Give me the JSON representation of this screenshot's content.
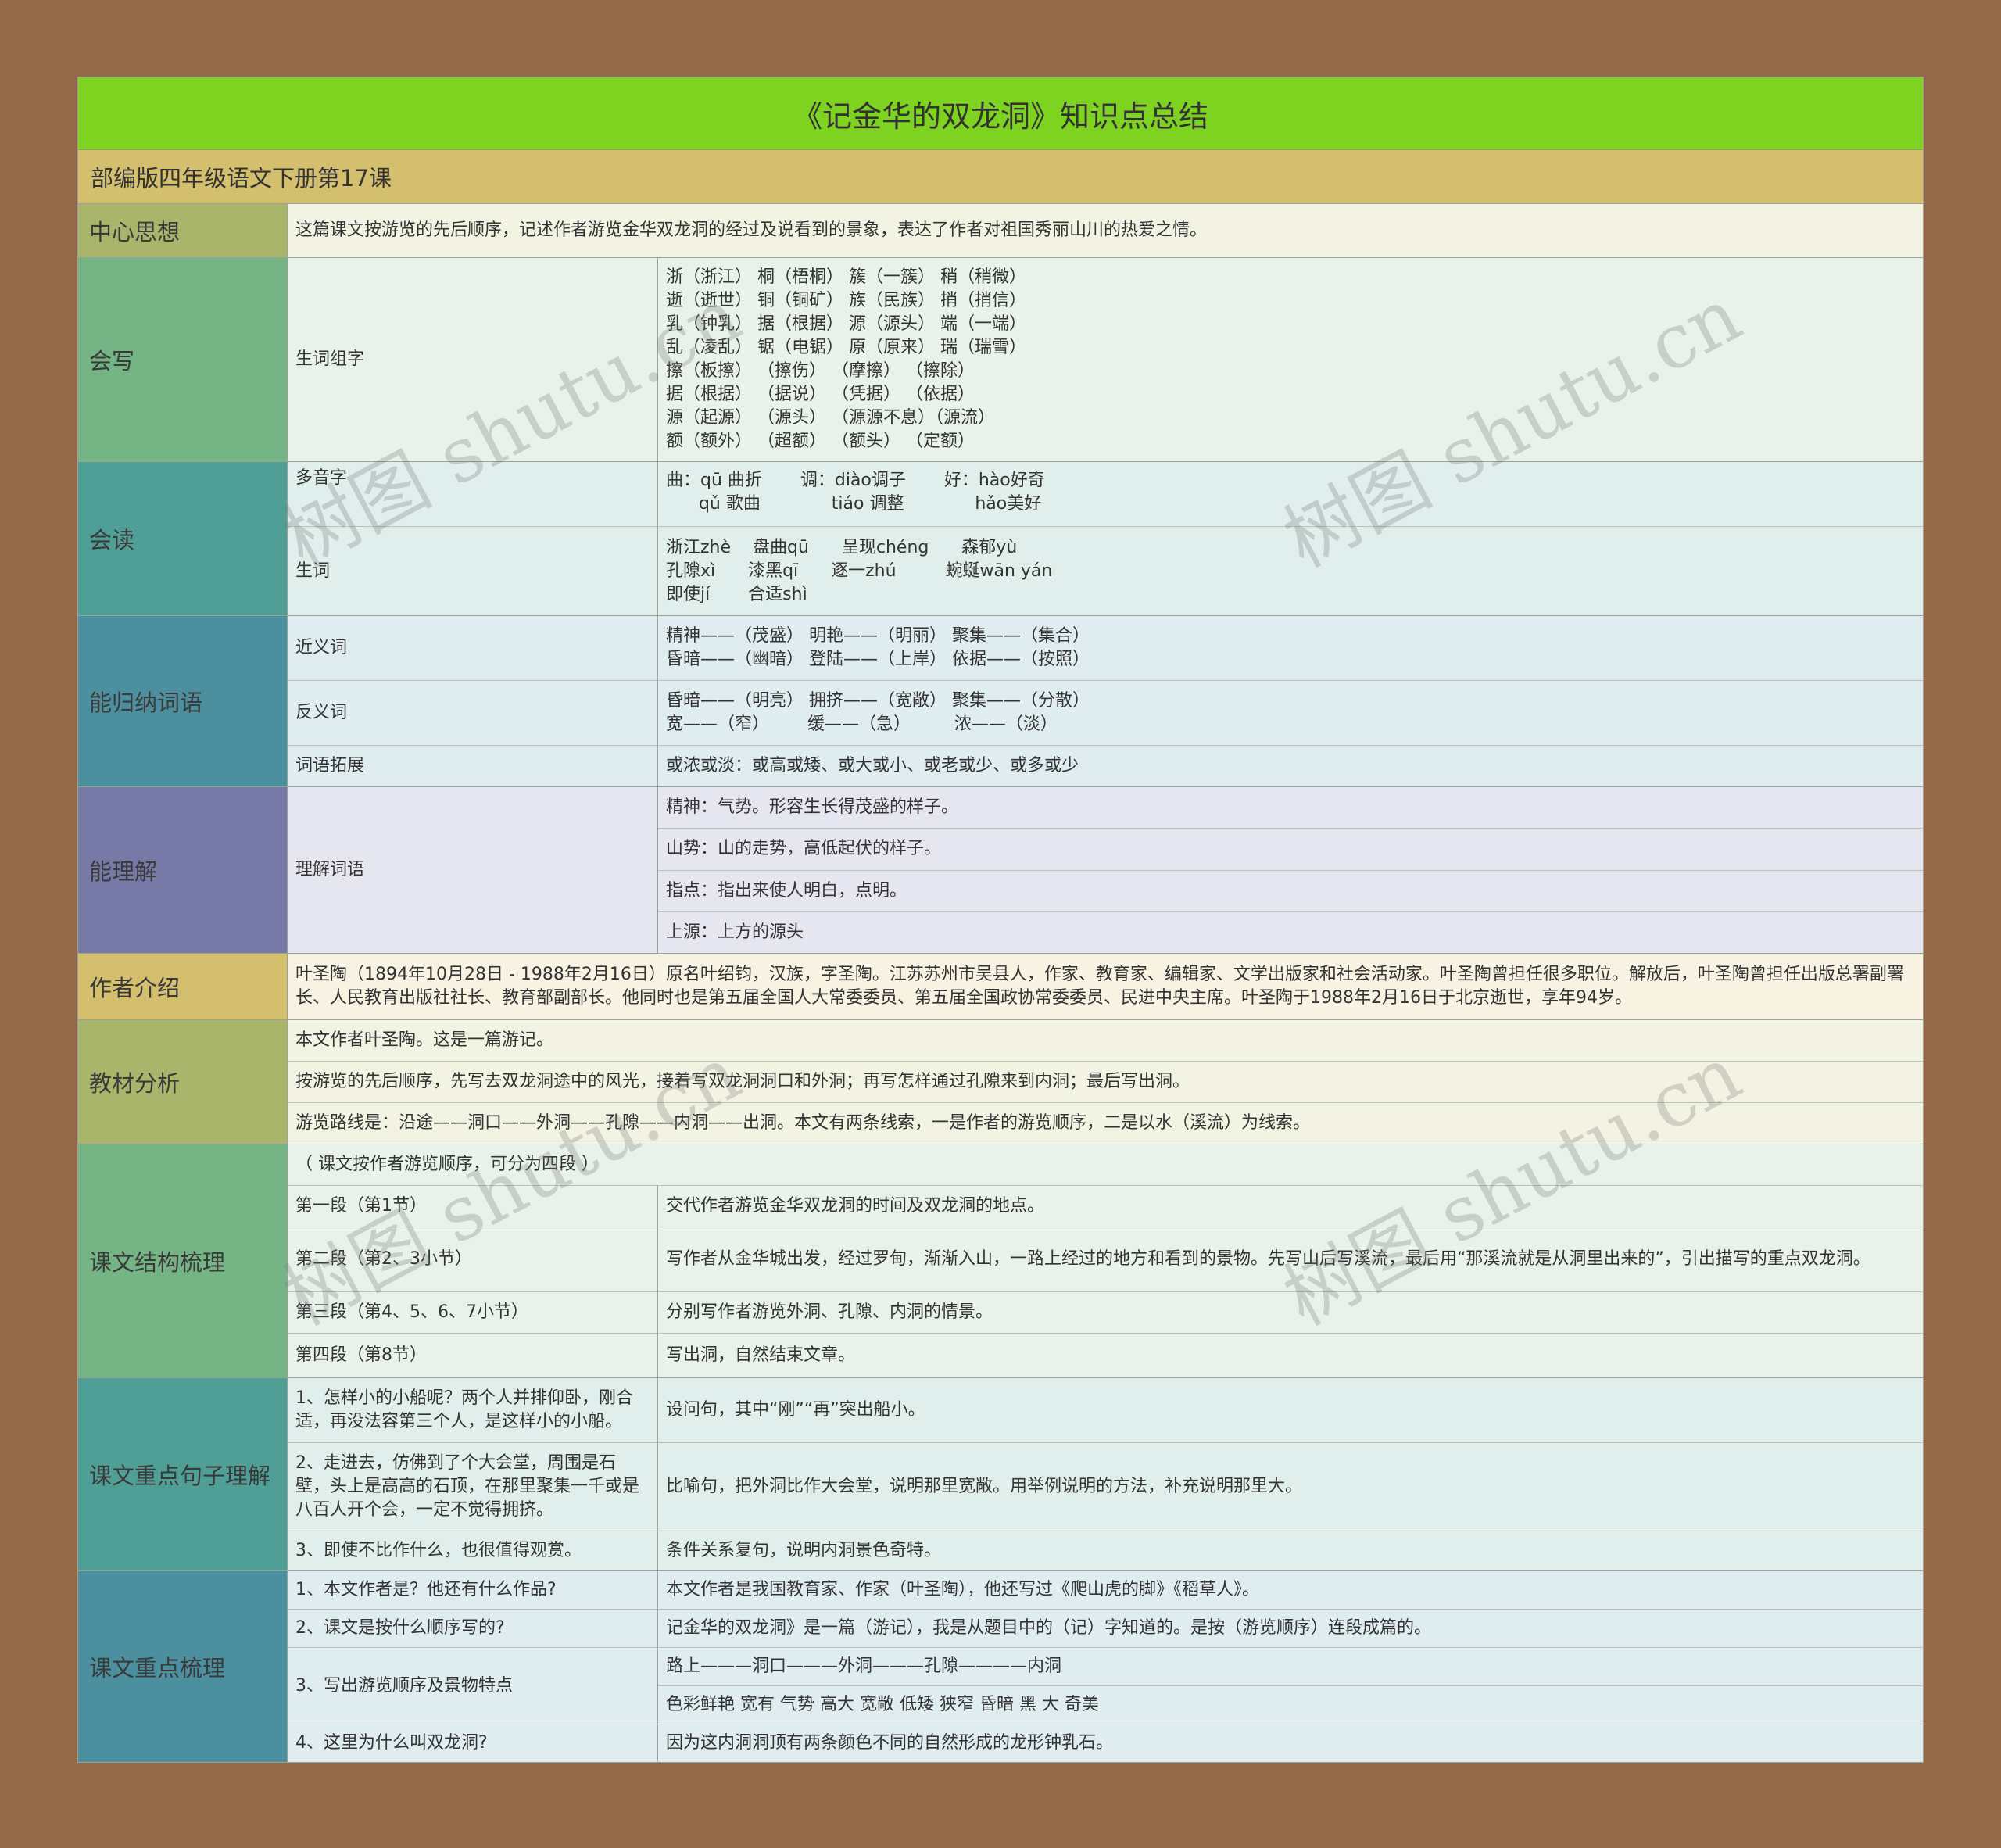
{
  "title": "《记金华的双龙洞》知识点总结",
  "subtitle": "部编版四年级语文下册第17课",
  "watermark": "树图 shutu.cn",
  "colors": {
    "page_bg": "#94694a",
    "title_bg": "#7ed321",
    "subtitle_bg": "#d4bf6e"
  },
  "sections": {
    "center": {
      "label": "中心思想",
      "text": "这篇课文按游览的先后顺序，记述作者游览金华双龙洞的经过及说看到的景象，表达了作者对祖国秀丽山川的热爱之情。"
    },
    "write": {
      "label": "会写",
      "sub": "生词组字",
      "text": "浙（浙江） 桐（梧桐） 簇（一簇） 稍（稍微）\n逝（逝世） 铜（铜矿） 族（民族） 捎（捎信）\n乳（钟乳） 据（根据） 源（源头） 端（一端）\n乱（凌乱） 锯（电锯） 原（原来） 瑞（瑞雪）\n擦（板擦） （擦伤） （摩擦） （擦除）\n据（根据） （据说） （凭据） （依据）\n源（起源） （源头） （源源不息）（源流）\n额（额外） （超额） （额头） （定额）"
    },
    "read": {
      "label": "会读",
      "rows": [
        {
          "sub": "多音字",
          "text": "曲：qū 曲折       调：diào调子       好：hào好奇\n      qǔ 歌曲             tiáo 调整             hǎo美好"
        },
        {
          "sub": "生词",
          "text": "浙江zhè    盘曲qū      呈现chéng      森郁yù\n孔隙xì      漆黑qī      逐一zhú         蜿蜒wān yán\n即使jí       合适shì"
        }
      ]
    },
    "words": {
      "label": "能归纳词语",
      "rows": [
        {
          "sub": "近义词",
          "text": "精神——（茂盛） 明艳——（明丽） 聚集——（集合）\n昏暗——（幽暗） 登陆——（上岸） 依据——（按照）"
        },
        {
          "sub": "反义词",
          "text": "昏暗——（明亮） 拥挤——（宽敞） 聚集——（分散）\n宽——（窄）       缓——（急）        浓——（淡）"
        },
        {
          "sub": "词语拓展",
          "text": "或浓或淡：或高或矮、或大或小、或老或少、或多或少"
        }
      ]
    },
    "understand": {
      "label": "能理解",
      "sub": "理解词语",
      "items": [
        "精神：气势。形容生长得茂盛的样子。",
        "山势：山的走势，高低起伏的样子。",
        "指点：指出来使人明白，点明。",
        "上源：上方的源头"
      ]
    },
    "author": {
      "label": "作者介绍",
      "text": "叶圣陶（1894年10月28日 - 1988年2月16日）原名叶绍钧，汉族，字圣陶。江苏苏州市吴县人，作家、教育家、编辑家、文学出版家和社会活动家。叶圣陶曾担任很多职位。解放后，叶圣陶曾担任出版总署副署长、人民教育出版社社长、教育部副部长。他同时也是第五届全国人大常委委员、第五届全国政协常委委员、民进中央主席。叶圣陶于1988年2月16日于北京逝世，享年94岁。"
    },
    "analysis": {
      "label": "教材分析",
      "items": [
        "本文作者叶圣陶。这是一篇游记。",
        "按游览的先后顺序，先写去双龙洞途中的风光，接着写双龙洞洞口和外洞；再写怎样通过孔隙来到内洞；最后写出洞。",
        "游览路线是：沿途——洞口——外洞——孔隙——内洞——出洞。本文有两条线索，一是作者的游览顺序，二是以水（溪流）为线索。"
      ]
    },
    "structure": {
      "label": "课文结构梳理",
      "intro": "（ 课文按作者游览顺序，可分为四段 ）",
      "rows": [
        {
          "sub": "第一段（第1节）",
          "text": "交代作者游览金华双龙洞的时间及双龙洞的地点。"
        },
        {
          "sub": "第二段（第2、3小节）",
          "text": "写作者从金华城出发，经过罗甸，渐渐入山，一路上经过的地方和看到的景物。先写山后写溪流，最后用“那溪流就是从洞里出来的”，引出描写的重点双龙洞。"
        },
        {
          "sub": "第三段（第4、5、6、7小节）",
          "text": "分别写作者游览外洞、孔隙、内洞的情景。"
        },
        {
          "sub": "第四段（第8节）",
          "text": "写出洞，自然结束文章。"
        }
      ]
    },
    "sentences": {
      "label": "课文重点句子理解",
      "rows": [
        {
          "sub": "1、怎样小的小船呢？两个人并排仰卧，刚合适，再没法容第三个人，是这样小的小船。",
          "text": "设问句，其中“刚”“再”突出船小。"
        },
        {
          "sub": "2、走进去，仿佛到了个大会堂，周围是石壁，头上是高高的石顶，在那里聚集一千或是八百人开个会，一定不觉得拥挤。",
          "text": "比喻句，把外洞比作大会堂，说明那里宽敞。用举例说明的方法，补充说明那里大。"
        },
        {
          "sub": "3、即使不比作什么，也很值得观赏。",
          "text": "条件关系复句，说明内洞景色奇特。"
        }
      ]
    },
    "keypoints": {
      "label": "课文重点梳理",
      "rows": [
        {
          "sub": "1、本文作者是？他还有什么作品?",
          "items": [
            "本文作者是我国教育家、作家（叶圣陶），他还写过《爬山虎的脚》《稻草人》。"
          ]
        },
        {
          "sub": "2、课文是按什么顺序写的?",
          "items": [
            "记金华的双龙洞》是一篇（游记），我是从题目中的（记）字知道的。是按（游览顺序）连段成篇的。"
          ]
        },
        {
          "sub": "3、写出游览顺序及景物特点",
          "items": [
            "路上———洞口———外洞———孔隙————内洞",
            "色彩鲜艳 宽有 气势 高大 宽敞 低矮 狭窄 昏暗 黑 大 奇美"
          ]
        },
        {
          "sub": " 4、这里为什么叫双龙洞?",
          "items": [
            "因为这内洞洞顶有两条颜色不同的自然形成的龙形钟乳石。"
          ]
        }
      ]
    }
  }
}
